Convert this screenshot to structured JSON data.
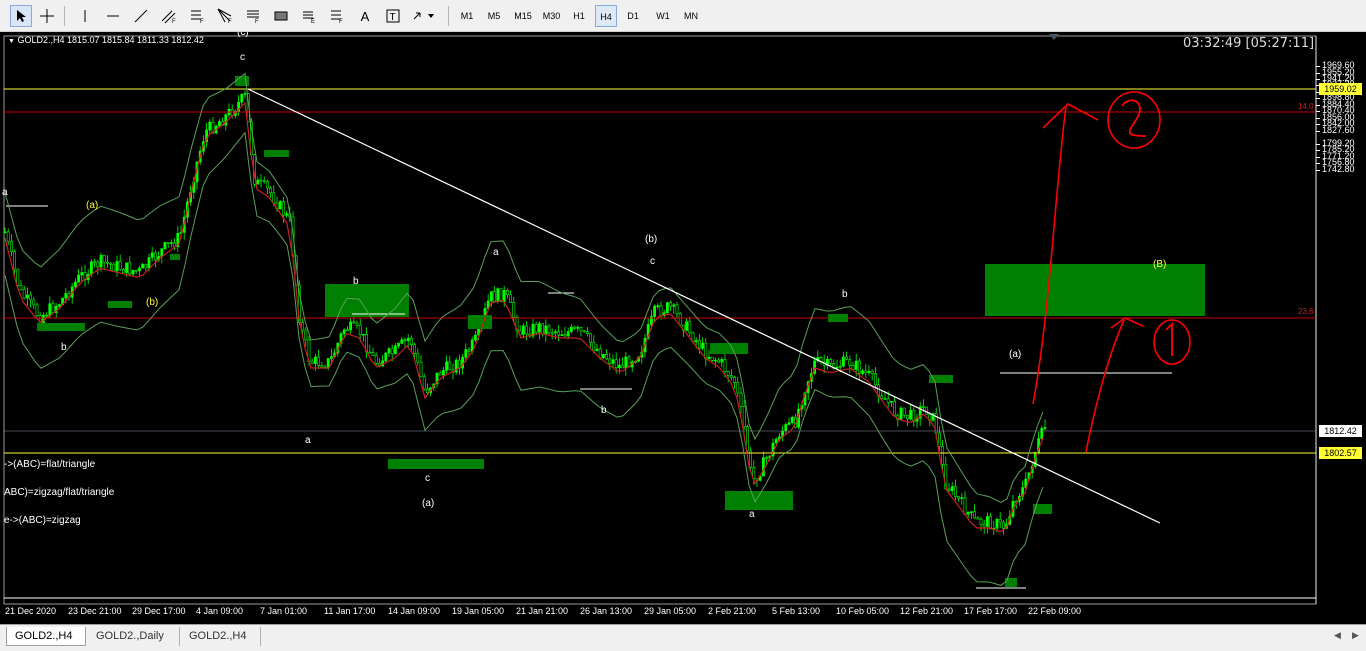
{
  "toolbar": {
    "tools": [
      "cursor-icon",
      "crosshair-icon",
      "vertical-line-icon",
      "horizontal-line-icon",
      "trendline-icon",
      "fibo-channel-icon",
      "equidistant-channel-icon",
      "fibo-retracement-icon",
      "fibo-fan-icon",
      "rectangle-icon",
      "elliott-wave-icon",
      "fibo-expansion-icon",
      "text-icon",
      "text-label-icon",
      "arrows-icon"
    ],
    "text_tool": "A",
    "timeframes": [
      "M1",
      "M5",
      "M15",
      "M30",
      "H1",
      "H4",
      "D1",
      "W1",
      "MN"
    ],
    "active_timeframe": "H4"
  },
  "chart": {
    "header": "GOLD2.,H4  1815.07 1815.84 1811.33 1812.42",
    "timer": "03:32:49 [05:27:11]",
    "price_ticks": [
      "1969.60",
      "1955.20",
      "1941.20",
      "1927.20",
      "1912.80",
      "1898.80",
      "1884.40",
      "1870.40",
      "1856.00",
      "1842.00",
      "1827.60",
      "1799.20",
      "1785.20",
      "1771.20",
      "1756.80",
      "1742.80"
    ],
    "price_labels": {
      "yellow_top": "1959.02",
      "current": "1812.42",
      "yellow_bottom": "1802.57"
    },
    "level_labels": {
      "fib_14": "14.0",
      "fib_236": "23.6"
    },
    "time_ticks": [
      "21 Dec 2020",
      "23 Dec 21:00",
      "29 Dec 17:00",
      "4 Jan 09:00",
      "7 Jan 01:00",
      "11 Jan 17:00",
      "14 Jan 09:00",
      "19 Jan 05:00",
      "21 Jan 21:00",
      "26 Jan 13:00",
      "29 Jan 05:00",
      "2 Feb 21:00",
      "5 Feb 13:00",
      "10 Feb 05:00",
      "12 Feb 21:00",
      "17 Feb 17:00",
      "22 Feb 09:00"
    ],
    "legend": [
      "->(ABC)=flat/triangle",
      "ABC)=zigzag/flat/triangle",
      "e->(ABC)=zigzag"
    ],
    "wave_labels": {
      "c_top": "c",
      "c_top_cut": "(c)",
      "a_left": "a",
      "paren_a_left": "(a)",
      "b_left": "b",
      "paren_b_left": "(b)",
      "b_mid": "b",
      "a_low1": "a",
      "c_low": "c",
      "paren_a_low": "(a)",
      "a_mid": "a",
      "b_mid2": "b",
      "paren_b_mid": "(b)",
      "c_mid": "c",
      "a_feb": "a",
      "b_feb": "b",
      "paren_a_right": "(a)",
      "paren_B": "(B)"
    },
    "colors": {
      "bull": "#00ff00",
      "band": "#5aa05a",
      "ma": "#cc2020",
      "trend": "#ffffff",
      "zone": "#008000",
      "yellow": "#ffff33",
      "red_level": "#cc0000",
      "annotation": "#ff0000"
    }
  },
  "tabs": [
    "GOLD2.,H4",
    "GOLD2.,Daily",
    "GOLD2.,H4"
  ],
  "active_tab": 0
}
